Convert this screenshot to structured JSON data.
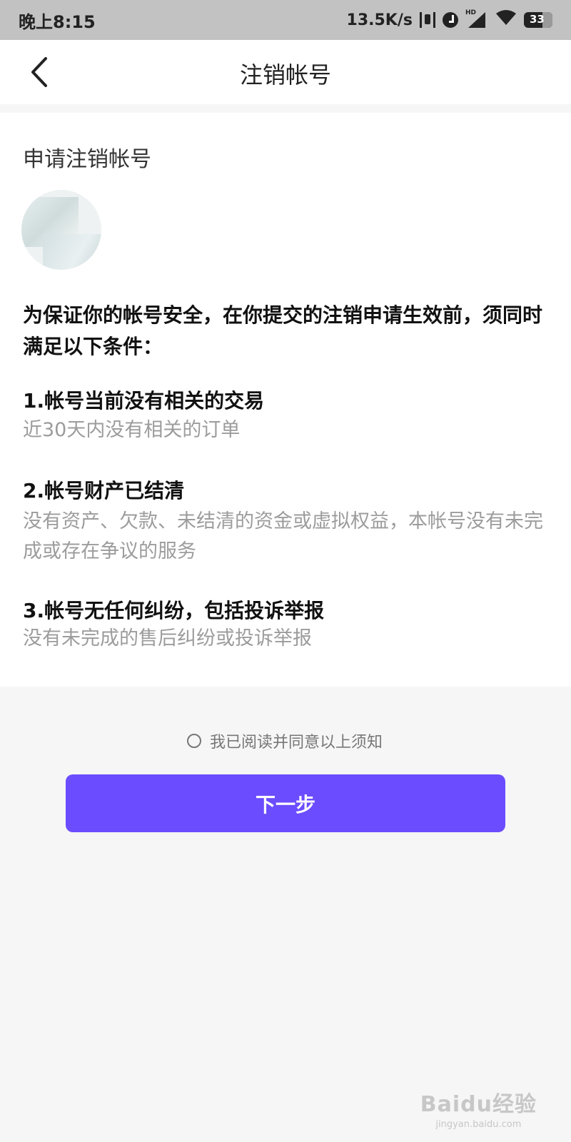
{
  "status_bar": {
    "time": "晚上8:15",
    "net_speed": "13.5K/s",
    "signal_badge": "HD",
    "battery_level": "33"
  },
  "header": {
    "title": "注销帐号"
  },
  "main": {
    "section_title": "申请注销帐号",
    "intro": "为保证你的帐号安全，在你提交的注销申请生效前，须同时满足以下条件：",
    "conditions": [
      {
        "title": "1.帐号当前没有相关的交易",
        "desc": "近30天内没有相关的订单"
      },
      {
        "title": "2.帐号财产已结清",
        "desc": "没有资产、欠款、未结清的资金或虚拟权益，本帐号没有未完成或存在争议的服务"
      },
      {
        "title": "3.帐号无任何纠纷，包括投诉举报",
        "desc": "没有未完成的售后纠纷或投诉举报"
      }
    ]
  },
  "agreement": {
    "label": "我已阅读并同意以上须知",
    "checked": false
  },
  "actions": {
    "next_label": "下一步"
  },
  "watermark": {
    "logo": "Baidu经验",
    "url": "jingyan.baidu.com"
  },
  "colors": {
    "accent": "#6b4dff",
    "status_bar_bg": "#c2c2c2",
    "page_bg": "#f6f6f6",
    "muted_text": "#9c9c9c"
  }
}
